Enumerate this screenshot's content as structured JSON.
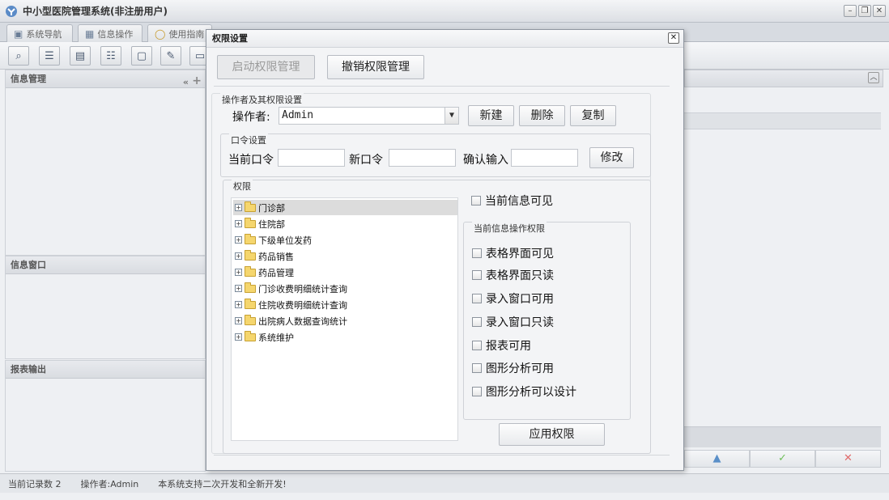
{
  "app": {
    "title": "中小型医院管理系统(非注册用户)"
  },
  "tabs": [
    {
      "label": "系统导航",
      "icon": "monitor-icon"
    },
    {
      "label": "信息操作",
      "icon": "grid-icon"
    },
    {
      "label": "使用指南",
      "icon": "help-icon"
    }
  ],
  "left_panels": {
    "info_manage": "信息管理",
    "info_window": "信息窗口",
    "report_output": "报表输出"
  },
  "status": {
    "record_count": "当前记录数 2",
    "operator": "操作者:Admin",
    "message": "本系统支持二次开发和全新开发!"
  },
  "dialog": {
    "title": "权限设置",
    "start_btn": "启动权限管理",
    "revoke_btn": "撤销权限管理",
    "operator_group": "操作者及其权限设置",
    "operator_label": "操作者:",
    "operator_value": "Admin",
    "new_btn": "新建",
    "delete_btn": "删除",
    "copy_btn": "复制",
    "password_group": "口令设置",
    "current_pw_label": "当前口令",
    "new_pw_label": "新口令",
    "confirm_pw_label": "确认输入",
    "modify_btn": "修改",
    "perm_group": "权限",
    "tree": [
      "门诊部",
      "住院部",
      "下级单位发药",
      "药品销售",
      "药品管理",
      "门诊收费明细统计查询",
      "住院收费明细统计查询",
      "出院病人数据查询统计",
      "系统维护"
    ],
    "info_visible": "当前信息可见",
    "ops_group": "当前信息操作权限",
    "ops": [
      "表格界面可见",
      "表格界面只读",
      "录入窗口可用",
      "录入窗口只读",
      "报表可用",
      "图形分析可用",
      "图形分析可以设计"
    ],
    "apply_btn": "应用权限"
  }
}
